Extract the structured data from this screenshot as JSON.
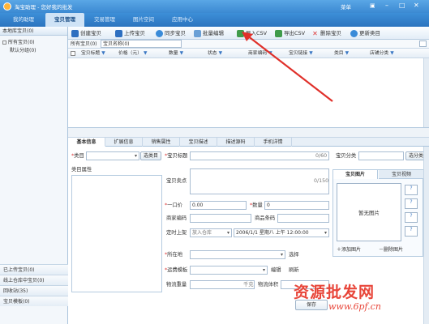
{
  "app": {
    "title": "淘宝助理 - 您好我的批发",
    "window_controls": "菜单"
  },
  "nav": {
    "tabs": [
      "我的助理",
      "宝贝管理",
      "交易管理",
      "图片空间",
      "应用中心"
    ],
    "active_index": 1
  },
  "sidebar": {
    "header": "本地库宝贝(0)",
    "tree": [
      {
        "label": "所有宝贝(0)"
      },
      {
        "label": "默认分组(0)"
      }
    ],
    "bottom_items": [
      "已上传宝贝(0)",
      "线上仓库中宝贝(0)",
      "回收站(35)",
      "宝贝模板(0)"
    ]
  },
  "toolbar": {
    "buttons": [
      "创建宝贝",
      "上传宝贝",
      "同步宝贝",
      "批量编辑",
      "导入CSV",
      "导出CSV",
      "删除宝贝",
      "更新类目"
    ]
  },
  "filter": {
    "label": "所有宝贝(0)",
    "value": "宝贝名称(0)"
  },
  "grid": {
    "columns": [
      "宝贝标题",
      "价格（元）",
      "数量",
      "状态",
      "商家编码",
      "宝贝链接",
      "类目",
      "店铺分类"
    ]
  },
  "tabs": {
    "items": [
      "基本信息",
      "扩展信息",
      "销售属性",
      "宝贝描述",
      "描述源码",
      "手机详情"
    ],
    "active_index": 0
  },
  "form": {
    "category_label": "类目",
    "category_select_btn": "选类目",
    "title_label": "宝贝标题",
    "title_counter": "0/60",
    "store_cat_label": "宝贝分类",
    "store_cat_btn": "选分类",
    "attr_label": "类目属性",
    "selling_label": "宝贝卖点",
    "selling_counter": "0/150",
    "price_label": "一口价",
    "price_value": "0.00",
    "qty_label": "数量",
    "qty_value": "0",
    "code_label": "商家编码",
    "barcode_label": "商品条码",
    "onsale_label": "定时上架",
    "onsale_mode": "放入仓库",
    "onsale_datetime": "2006/1/1 星期八 上午 12:00:00",
    "location_label": "所在地",
    "location_btn": "选择",
    "shipping_label": "运费模板",
    "shipping_edit": "编辑",
    "shipping_refresh": "刷新",
    "weight_label": "物流重量",
    "weight_unit": "千克",
    "volume_label": "物流体积",
    "save_label": "保存"
  },
  "image_panel": {
    "tabs": [
      "宝贝图片",
      "宝贝视频"
    ],
    "placeholder": "暂无图片",
    "add_label": "添加图片",
    "delete_label": "删除图片"
  },
  "watermark": {
    "line1": "资源批发网",
    "line2": "www.6pf.cn"
  },
  "colors": {
    "accent": "#2b74bf",
    "arrow": "#e0302a",
    "watermark": "#e8463a"
  }
}
